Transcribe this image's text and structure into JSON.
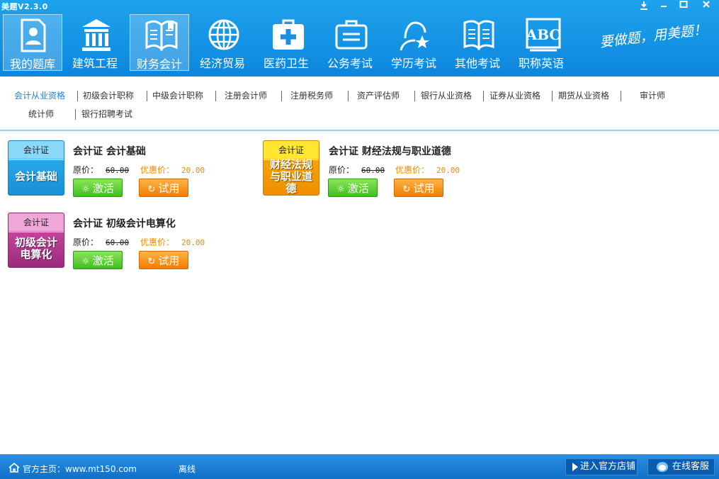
{
  "window": {
    "title": "美题V2.3.0"
  },
  "nav": [
    {
      "label": "我的题库",
      "icon": "user-book-icon",
      "active": true
    },
    {
      "label": "建筑工程",
      "icon": "building-icon"
    },
    {
      "label": "财务会计",
      "icon": "book-icon",
      "active": true
    },
    {
      "label": "经济贸易",
      "icon": "globe-icon"
    },
    {
      "label": "医药卫生",
      "icon": "medical-kit-icon"
    },
    {
      "label": "公务考试",
      "icon": "briefcase-icon"
    },
    {
      "label": "学历考试",
      "icon": "graduate-star-icon"
    },
    {
      "label": "其他考试",
      "icon": "open-book-icon"
    },
    {
      "label": "职称英语",
      "icon": "abc-icon"
    }
  ],
  "slogan": "要做题，用美题！",
  "tabs": [
    "会计从业资格",
    "初级会计职称",
    "中级会计职称",
    "注册会计师",
    "注册税务师",
    "资产评估师",
    "银行从业资格",
    "证券从业资格",
    "期货从业资格",
    "审计师",
    "统计师",
    "银行招聘考试"
  ],
  "products": [
    {
      "badge_top": "会计证",
      "badge_main": "会计基础",
      "title": "会计证  会计基础",
      "orig_label": "原价：",
      "orig_price": "60.00",
      "disc_label": "优惠价：",
      "disc_price": "20.00",
      "activate": "激活",
      "trial": "试用"
    },
    {
      "badge_top": "会计证",
      "badge_main": "财经法规与职业道德",
      "title": "会计证  财经法规与职业道德",
      "orig_label": "原价：",
      "orig_price": "60.00",
      "disc_label": "优惠价：",
      "disc_price": "20.00",
      "activate": "激活",
      "trial": "试用"
    },
    {
      "badge_top": "会计证",
      "badge_main": "初级会计电算化",
      "title": "会计证  初级会计电算化",
      "orig_label": "原价：",
      "orig_price": "60.00",
      "disc_label": "优惠价：",
      "disc_price": "20.00",
      "activate": "激活",
      "trial": "试用"
    }
  ],
  "footer": {
    "homepage": "官方主页：www.mt150.com",
    "status": "离线",
    "store": "进入官方店铺",
    "service": "在线客服"
  },
  "colors": {
    "header": "#1a9be8",
    "active_tab": "#1684d8",
    "discount": "#f08a00"
  }
}
